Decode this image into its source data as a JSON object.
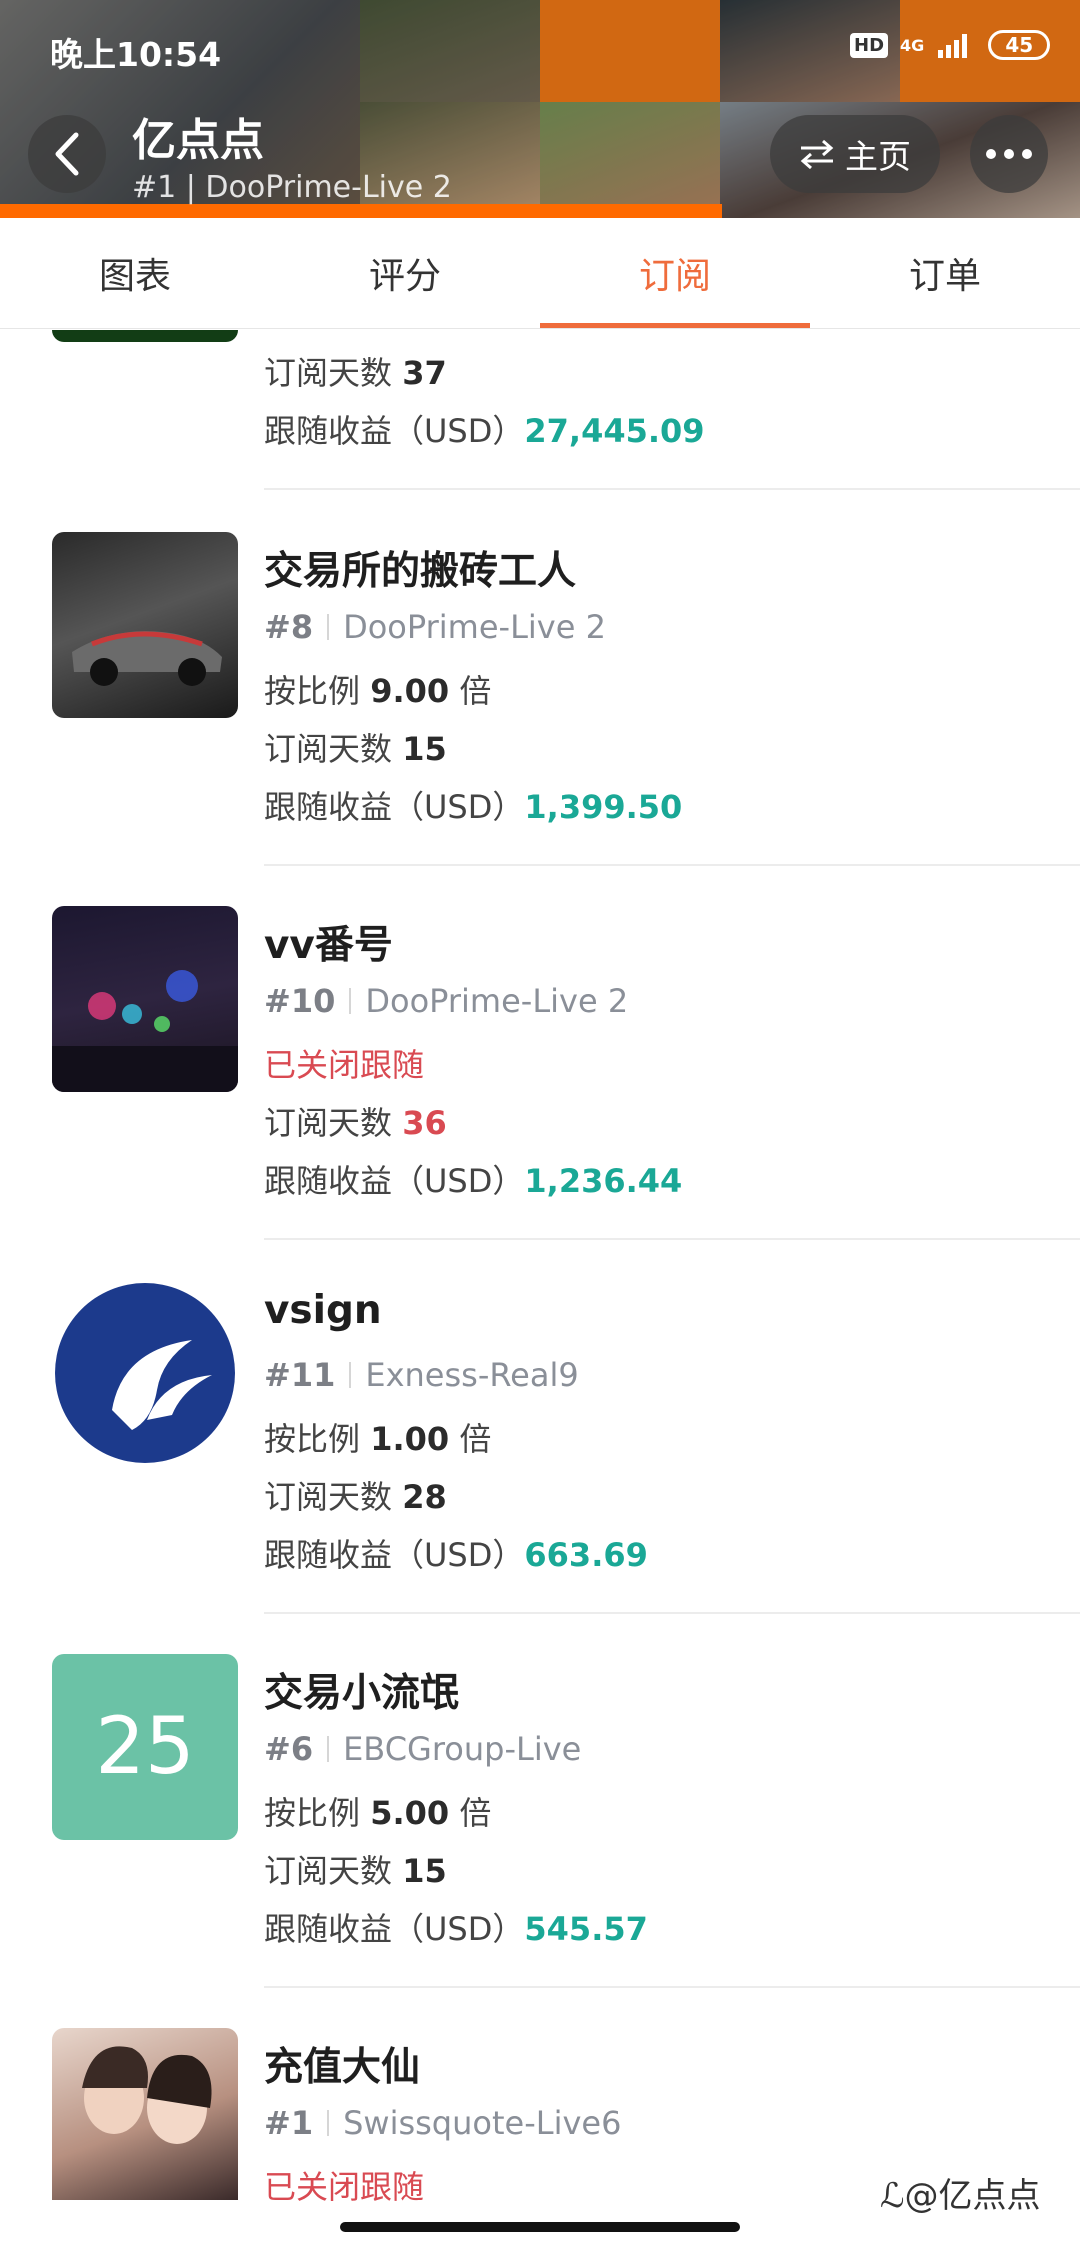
{
  "status": {
    "time": "晚上10:54",
    "hd": "HD",
    "network": "4G",
    "battery": "45"
  },
  "header": {
    "title": "亿点点",
    "subtitle": "#1 | DooPrime-Live 2",
    "home_label": "主页"
  },
  "tabs": [
    "图表",
    "评分",
    "订阅",
    "订单"
  ],
  "labels": {
    "ratio_prefix": "按比例",
    "ratio_suffix": "倍",
    "days_prefix": "订阅天数",
    "profit_prefix": "跟随收益（USD）",
    "closed": "已关闭跟随"
  },
  "partial_item": {
    "days": "37",
    "profit": "27,445.09"
  },
  "items": [
    {
      "name": "交易所的搬砖工人",
      "rank": "#8",
      "broker": "DooPrime-Live 2",
      "ratio": "9.00",
      "days": "15",
      "profit": "1,399.50"
    },
    {
      "name": "vv番号",
      "rank": "#10",
      "broker": "DooPrime-Live 2",
      "closed": "已关闭跟随",
      "days": "36",
      "profit": "1,236.44"
    },
    {
      "name": "vsign",
      "rank": "#11",
      "broker": "Exness-Real9",
      "ratio": "1.00",
      "days": "28",
      "profit": "663.69"
    },
    {
      "name": "交易小流氓",
      "rank": "#6",
      "broker": "EBCGroup-Live",
      "avatar_text": "25",
      "ratio": "5.00",
      "days": "15",
      "profit": "545.57"
    },
    {
      "name": "充值大仙",
      "rank": "#1",
      "broker": "Swissquote-Live6",
      "closed": "已关闭跟随"
    }
  ],
  "watermark": "@亿点点",
  "colors": {
    "accent": "#ef6c3c",
    "profit": "#1aa896",
    "warn": "#d94a52"
  }
}
